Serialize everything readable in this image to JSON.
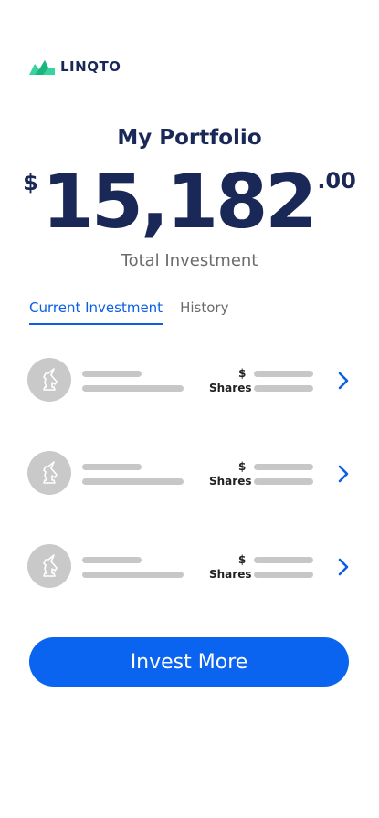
{
  "brand": {
    "name": "LINQTO",
    "logo_icon": "linqto-logo-icon",
    "colors": {
      "green": "#38d39f",
      "navy": "#1a2857"
    }
  },
  "portfolio": {
    "title": "My Portfolio",
    "currency_symbol": "$",
    "amount_whole": "15,182",
    "amount_cents": ".00",
    "caption": "Total Investment"
  },
  "tabs": [
    {
      "label": "Current Investment",
      "active": true
    },
    {
      "label": "History",
      "active": false
    }
  ],
  "holdings": [
    {
      "icon": "unicorn-icon",
      "dollar_label": "$",
      "shares_label": "Shares",
      "loading": true
    },
    {
      "icon": "unicorn-icon",
      "dollar_label": "$",
      "shares_label": "Shares",
      "loading": true
    },
    {
      "icon": "unicorn-icon",
      "dollar_label": "$",
      "shares_label": "Shares",
      "loading": true
    }
  ],
  "actions": {
    "invest_more_label": "Invest More"
  },
  "colors": {
    "accent": "#0a64f0",
    "tab_active": "#0a5fe5",
    "skeleton": "#c7c7c7",
    "muted_text": "#6b6b6b"
  }
}
